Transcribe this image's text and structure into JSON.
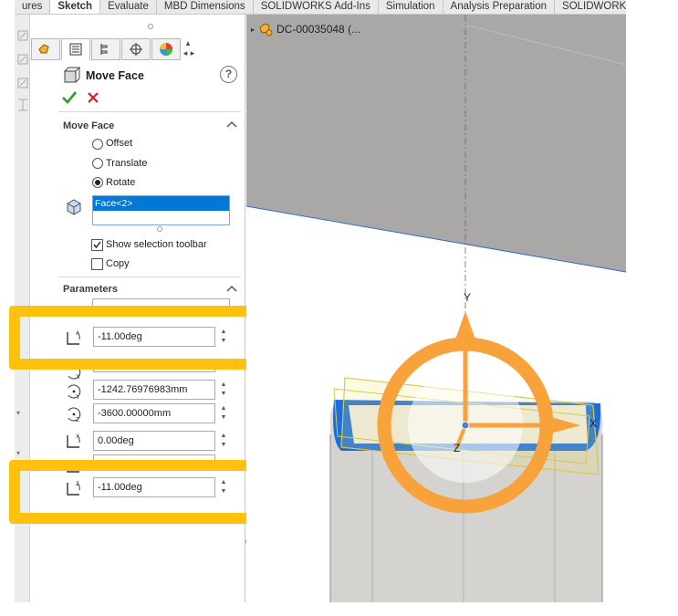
{
  "tabs": [
    {
      "label": "ures",
      "active": false
    },
    {
      "label": "Sketch",
      "active": true
    },
    {
      "label": "Evaluate",
      "active": false
    },
    {
      "label": "MBD Dimensions",
      "active": false
    },
    {
      "label": "SOLIDWORKS Add-Ins",
      "active": false
    },
    {
      "label": "Simulation",
      "active": false
    },
    {
      "label": "Analysis Preparation",
      "active": false
    },
    {
      "label": "SOLIDWORKS CA",
      "active": false
    }
  ],
  "property_manager": {
    "title": "Move Face",
    "help_icon": "question-icon",
    "ok_icon": "check-icon",
    "cancel_icon": "x-icon",
    "move_face": {
      "title": "Move Face",
      "options": [
        {
          "label": "Offset",
          "selected": false
        },
        {
          "label": "Translate",
          "selected": false
        },
        {
          "label": "Rotate",
          "selected": true
        }
      ],
      "selection_item": "Face<2>",
      "show_selection_toolbar_label": "Show selection toolbar",
      "show_selection_toolbar_checked": true,
      "copy_label": "Copy",
      "copy_checked": false
    },
    "parameters": {
      "title": "Parameters",
      "angle_a": "-11.00deg",
      "center_y": "-1242.76976983mm",
      "center_z": "-3600.00000mm",
      "angle_x": "0.00deg",
      "angle_z": "-11.00deg"
    }
  },
  "tree": {
    "item_label": "DC-00035048  (..."
  },
  "triad": {
    "label_x": "X",
    "label_y": "Y",
    "label_z": "Z"
  },
  "colors": {
    "highlight": "#fec20e",
    "triad": "#f7a23b",
    "selection": "#0078d7",
    "face_blue": "#1a6fe0",
    "check_green": "#22a022",
    "cancel_red": "#d81e1e"
  }
}
